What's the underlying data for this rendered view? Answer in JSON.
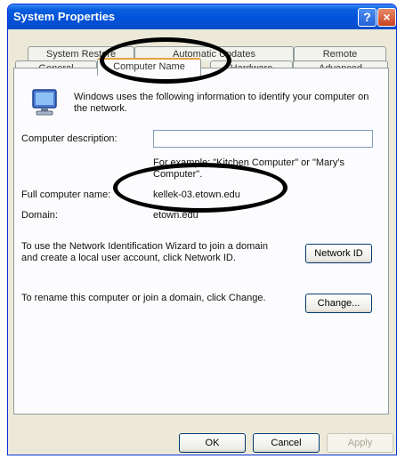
{
  "window": {
    "title": "System Properties",
    "help_glyph": "?",
    "close_glyph": "×"
  },
  "tabs": {
    "row1": [
      "System Restore",
      "Automatic Updates",
      "Remote"
    ],
    "row2": [
      "General",
      "Computer Name",
      "Hardware",
      "Advanced"
    ],
    "active": "Computer Name"
  },
  "panel": {
    "intro": "Windows uses the following information to identify your computer on the network.",
    "description_label": "Computer description:",
    "description_value": "",
    "example_hint": "For example: \"Kitchen Computer\" or \"Mary's Computer\".",
    "full_name_label": "Full computer name:",
    "full_name_value": "kellek-03.etown.edu",
    "domain_label": "Domain:",
    "domain_value": "etown.edu",
    "wizard_text": "To use the Network Identification Wizard to join a domain and create a local user account, click Network ID.",
    "network_id_button": "Network ID",
    "rename_text": "To rename this computer or join a domain, click Change.",
    "change_button": "Change..."
  },
  "footer": {
    "ok": "OK",
    "cancel": "Cancel",
    "apply": "Apply"
  },
  "icon_names": [
    "computer-icon",
    "help-icon",
    "close-icon"
  ],
  "colors": {
    "titlebar": "#0050d8",
    "dialog_bg": "#ece9d8",
    "tab_highlight": "#e8a33a",
    "annotation": "#000000"
  }
}
